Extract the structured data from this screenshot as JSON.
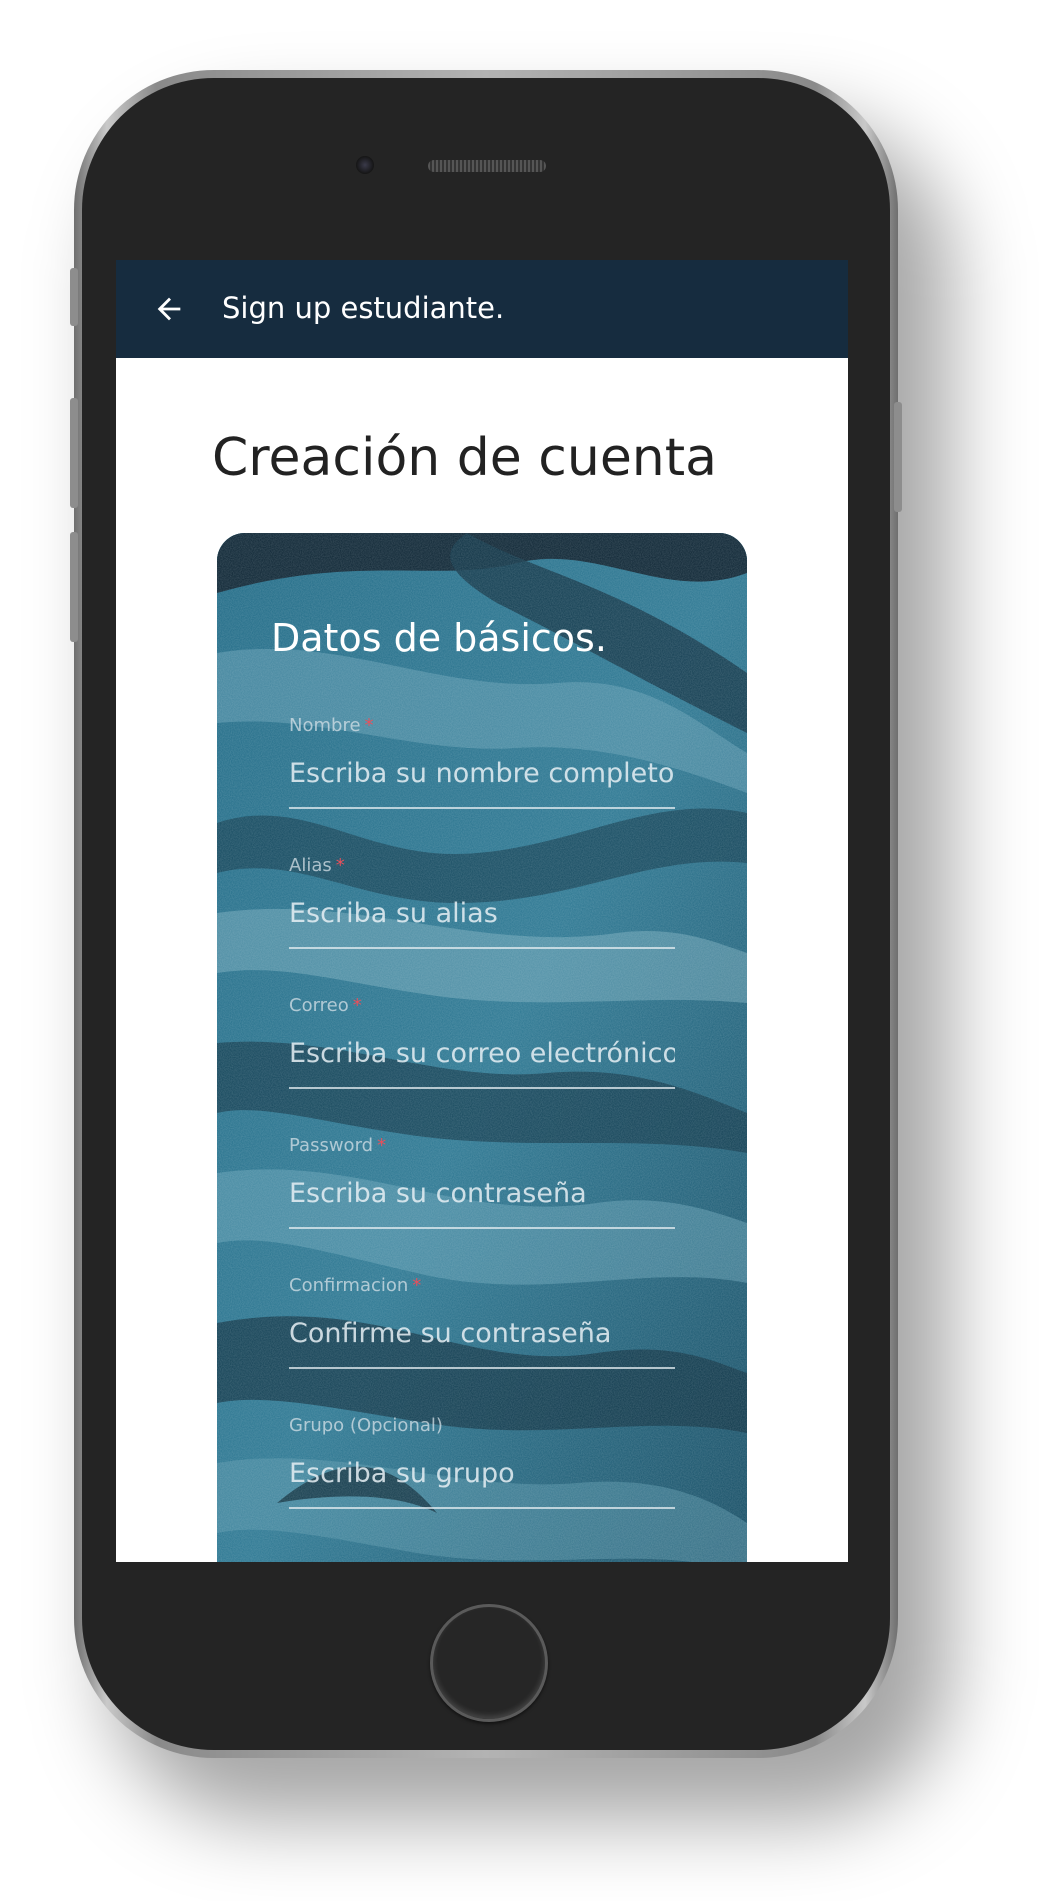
{
  "appbar": {
    "title": "Sign up estudiante.",
    "back_icon": "arrow-left-icon"
  },
  "page": {
    "title": "Creación de cuenta"
  },
  "card": {
    "title": "Datos de básicos.",
    "fields": [
      {
        "label": "Nombre",
        "required_mark": "*",
        "placeholder": "Escriba su nombre completo"
      },
      {
        "label": "Alias",
        "required_mark": "*",
        "placeholder": "Escriba su alias"
      },
      {
        "label": "Correo",
        "required_mark": "*",
        "placeholder": "Escriba su correo electrónico"
      },
      {
        "label": "Password",
        "required_mark": "*",
        "placeholder": "Escriba su contraseña"
      },
      {
        "label": "Confirmacion",
        "required_mark": "*",
        "placeholder": "Confirme su contraseña"
      },
      {
        "label": "Grupo (Opcional)",
        "required_mark": "",
        "placeholder": "Escriba su grupo"
      }
    ]
  },
  "colors": {
    "appbar": "#162c3f",
    "card_base": "#17546d",
    "required": "#e8505b"
  }
}
